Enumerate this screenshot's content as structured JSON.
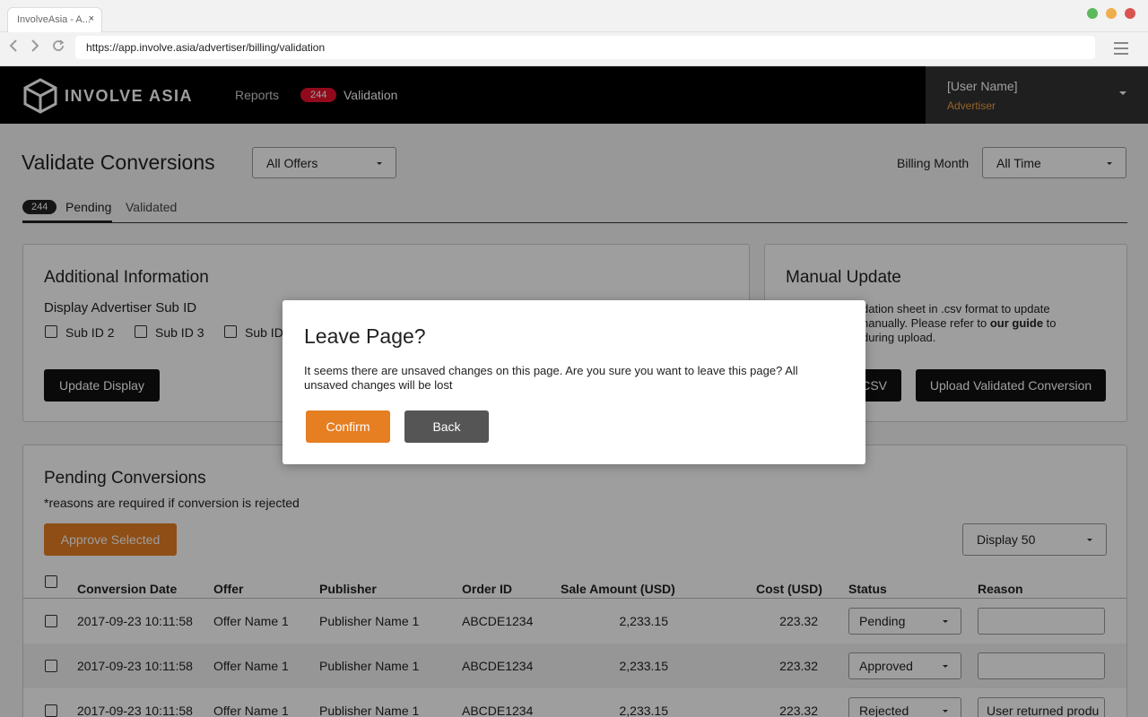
{
  "browser": {
    "tab_title": "InvolveAsia - A...",
    "tab_close": "×",
    "url": "https://app.involve.asia/advertiser/billing/validation",
    "dots": [
      "#5cb85c",
      "#f0ad4e",
      "#d9534f"
    ]
  },
  "header": {
    "logo_text": "INVOLVE ASIA",
    "nav_reports": "Reports",
    "validation_count": "244",
    "nav_validation": "Validation",
    "user_name": "[User Name]",
    "user_role": "Advertiser"
  },
  "page": {
    "title": "Validate Conversions",
    "offers_select": "All Offers",
    "billing_label": "Billing Month",
    "billing_select": "All Time",
    "tabs": {
      "pending_count": "244",
      "pending": "Pending",
      "validated": "Validated"
    }
  },
  "additional": {
    "title": "Additional Information",
    "subtitle": "Display Advertiser Sub ID",
    "sub_ids": [
      "Sub ID 2",
      "Sub ID 3",
      "Sub ID"
    ],
    "update_button": "Update Display"
  },
  "manual": {
    "title": "Manual Update",
    "line1": "dation sheet in .csv format to update",
    "line2_pre": "nanually. Please refer to ",
    "line2_link": "our guide",
    "line2_post": " to",
    "line3": "during upload.",
    "csv_button": "CSV",
    "upload_button": "Upload Validated Conversion"
  },
  "pending": {
    "title": "Pending Conversions",
    "note": "*reasons are required if conversion is rejected",
    "approve_button": "Approve Selected",
    "display_select": "Display 50",
    "columns": [
      "Conversion Date",
      "Offer",
      "Publisher",
      "Order ID",
      "Sale Amount (USD)",
      "Cost (USD)",
      "Status",
      "Reason"
    ],
    "rows": [
      {
        "date": "2017-09-23 10:11:58",
        "offer": "Offer Name 1",
        "publisher": "Publisher Name 1",
        "order_id": "ABCDE1234",
        "sale": "2,233.15",
        "cost": "223.32",
        "status": "Pending",
        "reason": ""
      },
      {
        "date": "2017-09-23 10:11:58",
        "offer": "Offer Name 1",
        "publisher": "Publisher Name 1",
        "order_id": "ABCDE1234",
        "sale": "2,233.15",
        "cost": "223.32",
        "status": "Approved",
        "reason": ""
      },
      {
        "date": "2017-09-23 10:11:58",
        "offer": "Offer Name 1",
        "publisher": "Publisher Name 1",
        "order_id": "ABCDE1234",
        "sale": "2,233.15",
        "cost": "223.32",
        "status": "Rejected",
        "reason": "User returned produ"
      }
    ]
  },
  "modal": {
    "title": "Leave Page?",
    "text": "It seems there are unsaved changes on this page. Are you sure you want to leave this page? All unsaved changes will be lost",
    "confirm": "Confirm",
    "back": "Back"
  }
}
